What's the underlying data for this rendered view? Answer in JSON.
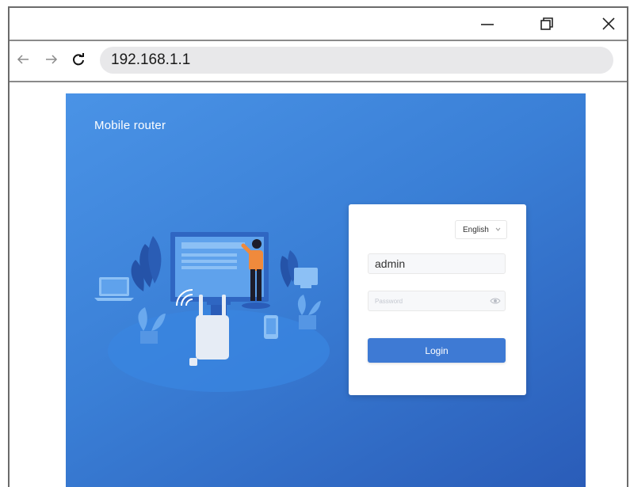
{
  "window": {
    "controls": {
      "minimize_icon": "minimize-icon",
      "maximize_icon": "restore-icon",
      "close_icon": "close-icon"
    }
  },
  "browser": {
    "nav": {
      "back_icon": "arrow-left-icon",
      "forward_icon": "arrow-right-icon",
      "reload_icon": "reload-icon"
    },
    "address": "192.168.1.1"
  },
  "page": {
    "brand": "Mobile router",
    "login": {
      "language": "English",
      "username_value": "admin",
      "password_placeholder": "Password",
      "login_label": "Login"
    }
  },
  "colors": {
    "banner_start": "#4a93e6",
    "banner_end": "#2a5cb8",
    "login_button": "#3e7ad4",
    "address_bar": "#e8e8ea"
  }
}
